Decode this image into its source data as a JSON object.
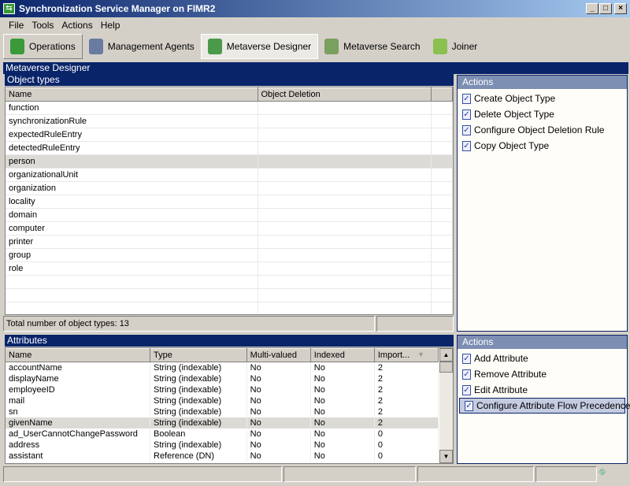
{
  "window": {
    "title": "Synchronization Service Manager on FIMR2"
  },
  "menu": [
    "File",
    "Tools",
    "Actions",
    "Help"
  ],
  "toolbar": [
    {
      "label": "Operations",
      "icon": "operations-book-icon"
    },
    {
      "label": "Management Agents",
      "icon": "management-agents-icon"
    },
    {
      "label": "Metaverse Designer",
      "icon": "metaverse-designer-icon"
    },
    {
      "label": "Metaverse Search",
      "icon": "metaverse-search-icon"
    },
    {
      "label": "Joiner",
      "icon": "joiner-icon"
    }
  ],
  "main": {
    "title": "Metaverse Designer"
  },
  "object_types": {
    "title": "Object types",
    "columns": [
      "Name",
      "Object Deletion"
    ],
    "rows": [
      "function",
      "synchronizationRule",
      "expectedRuleEntry",
      "detectedRuleEntry",
      "person",
      "organizationalUnit",
      "organization",
      "locality",
      "domain",
      "computer",
      "printer",
      "group",
      "role"
    ],
    "selected": "person",
    "total": "Total number of object types: 13"
  },
  "object_actions": {
    "title": "Actions",
    "items": [
      "Create Object Type",
      "Delete Object Type",
      "Configure Object Deletion Rule",
      "Copy Object Type"
    ]
  },
  "attributes": {
    "title": "Attributes",
    "columns": [
      "Name",
      "Type",
      "Multi-valued",
      "Indexed",
      "Import..."
    ],
    "rows": [
      [
        "accountName",
        "String (indexable)",
        "No",
        "No",
        "2"
      ],
      [
        "displayName",
        "String (indexable)",
        "No",
        "No",
        "2"
      ],
      [
        "employeeID",
        "String (indexable)",
        "No",
        "No",
        "2"
      ],
      [
        "mail",
        "String (indexable)",
        "No",
        "No",
        "2"
      ],
      [
        "sn",
        "String (indexable)",
        "No",
        "No",
        "2"
      ],
      [
        "givenName",
        "String (indexable)",
        "No",
        "No",
        "2"
      ],
      [
        "ad_UserCannotChangePassword",
        "Boolean",
        "No",
        "No",
        "0"
      ],
      [
        "address",
        "String (indexable)",
        "No",
        "No",
        "0"
      ],
      [
        "assistant",
        "Reference (DN)",
        "No",
        "No",
        "0"
      ]
    ],
    "selected": "givenName"
  },
  "attribute_actions": {
    "title": "Actions",
    "items": [
      "Add Attribute",
      "Remove Attribute",
      "Edit Attribute",
      "Configure Attribute Flow Precedence"
    ],
    "selected": "Configure Attribute Flow Precedence"
  },
  "colors": {
    "header": "#0a246a",
    "actions_header": "#7d8eb3",
    "chrome": "#d4d0c8"
  }
}
